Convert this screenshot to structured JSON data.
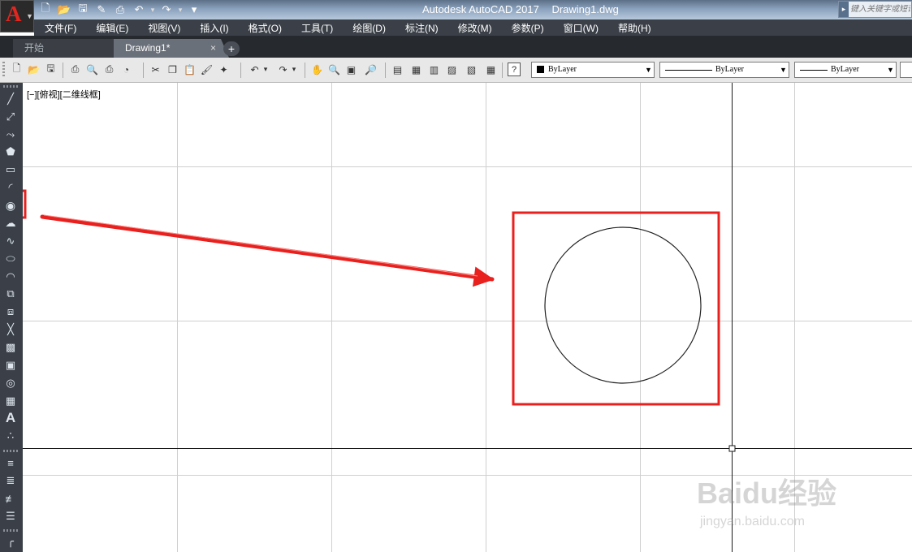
{
  "titlebar": {
    "app_name": "Autodesk AutoCAD 2017",
    "file_name": "Drawing1.dwg",
    "search_placeholder": "键入关键字或短语"
  },
  "menu": [
    "文件(F)",
    "编辑(E)",
    "视图(V)",
    "插入(I)",
    "格式(O)",
    "工具(T)",
    "绘图(D)",
    "标注(N)",
    "修改(M)",
    "参数(P)",
    "窗口(W)",
    "帮助(H)"
  ],
  "tabs": {
    "start": "开始",
    "drawing": "Drawing1*",
    "close": "×",
    "add": "+"
  },
  "toolbar": {
    "color_value": "ByLayer",
    "linetype_value": "ByLayer",
    "lineweight_value": "ByLayer"
  },
  "canvas": {
    "viewport_label": "[−][俯视][二维线框]",
    "watermark_text": "Baidu经验",
    "watermark_url": "jingyan.baidu.com"
  },
  "annotation": {
    "highlight_color": "#e8201e",
    "highlighted_tool": "circle-icon"
  }
}
